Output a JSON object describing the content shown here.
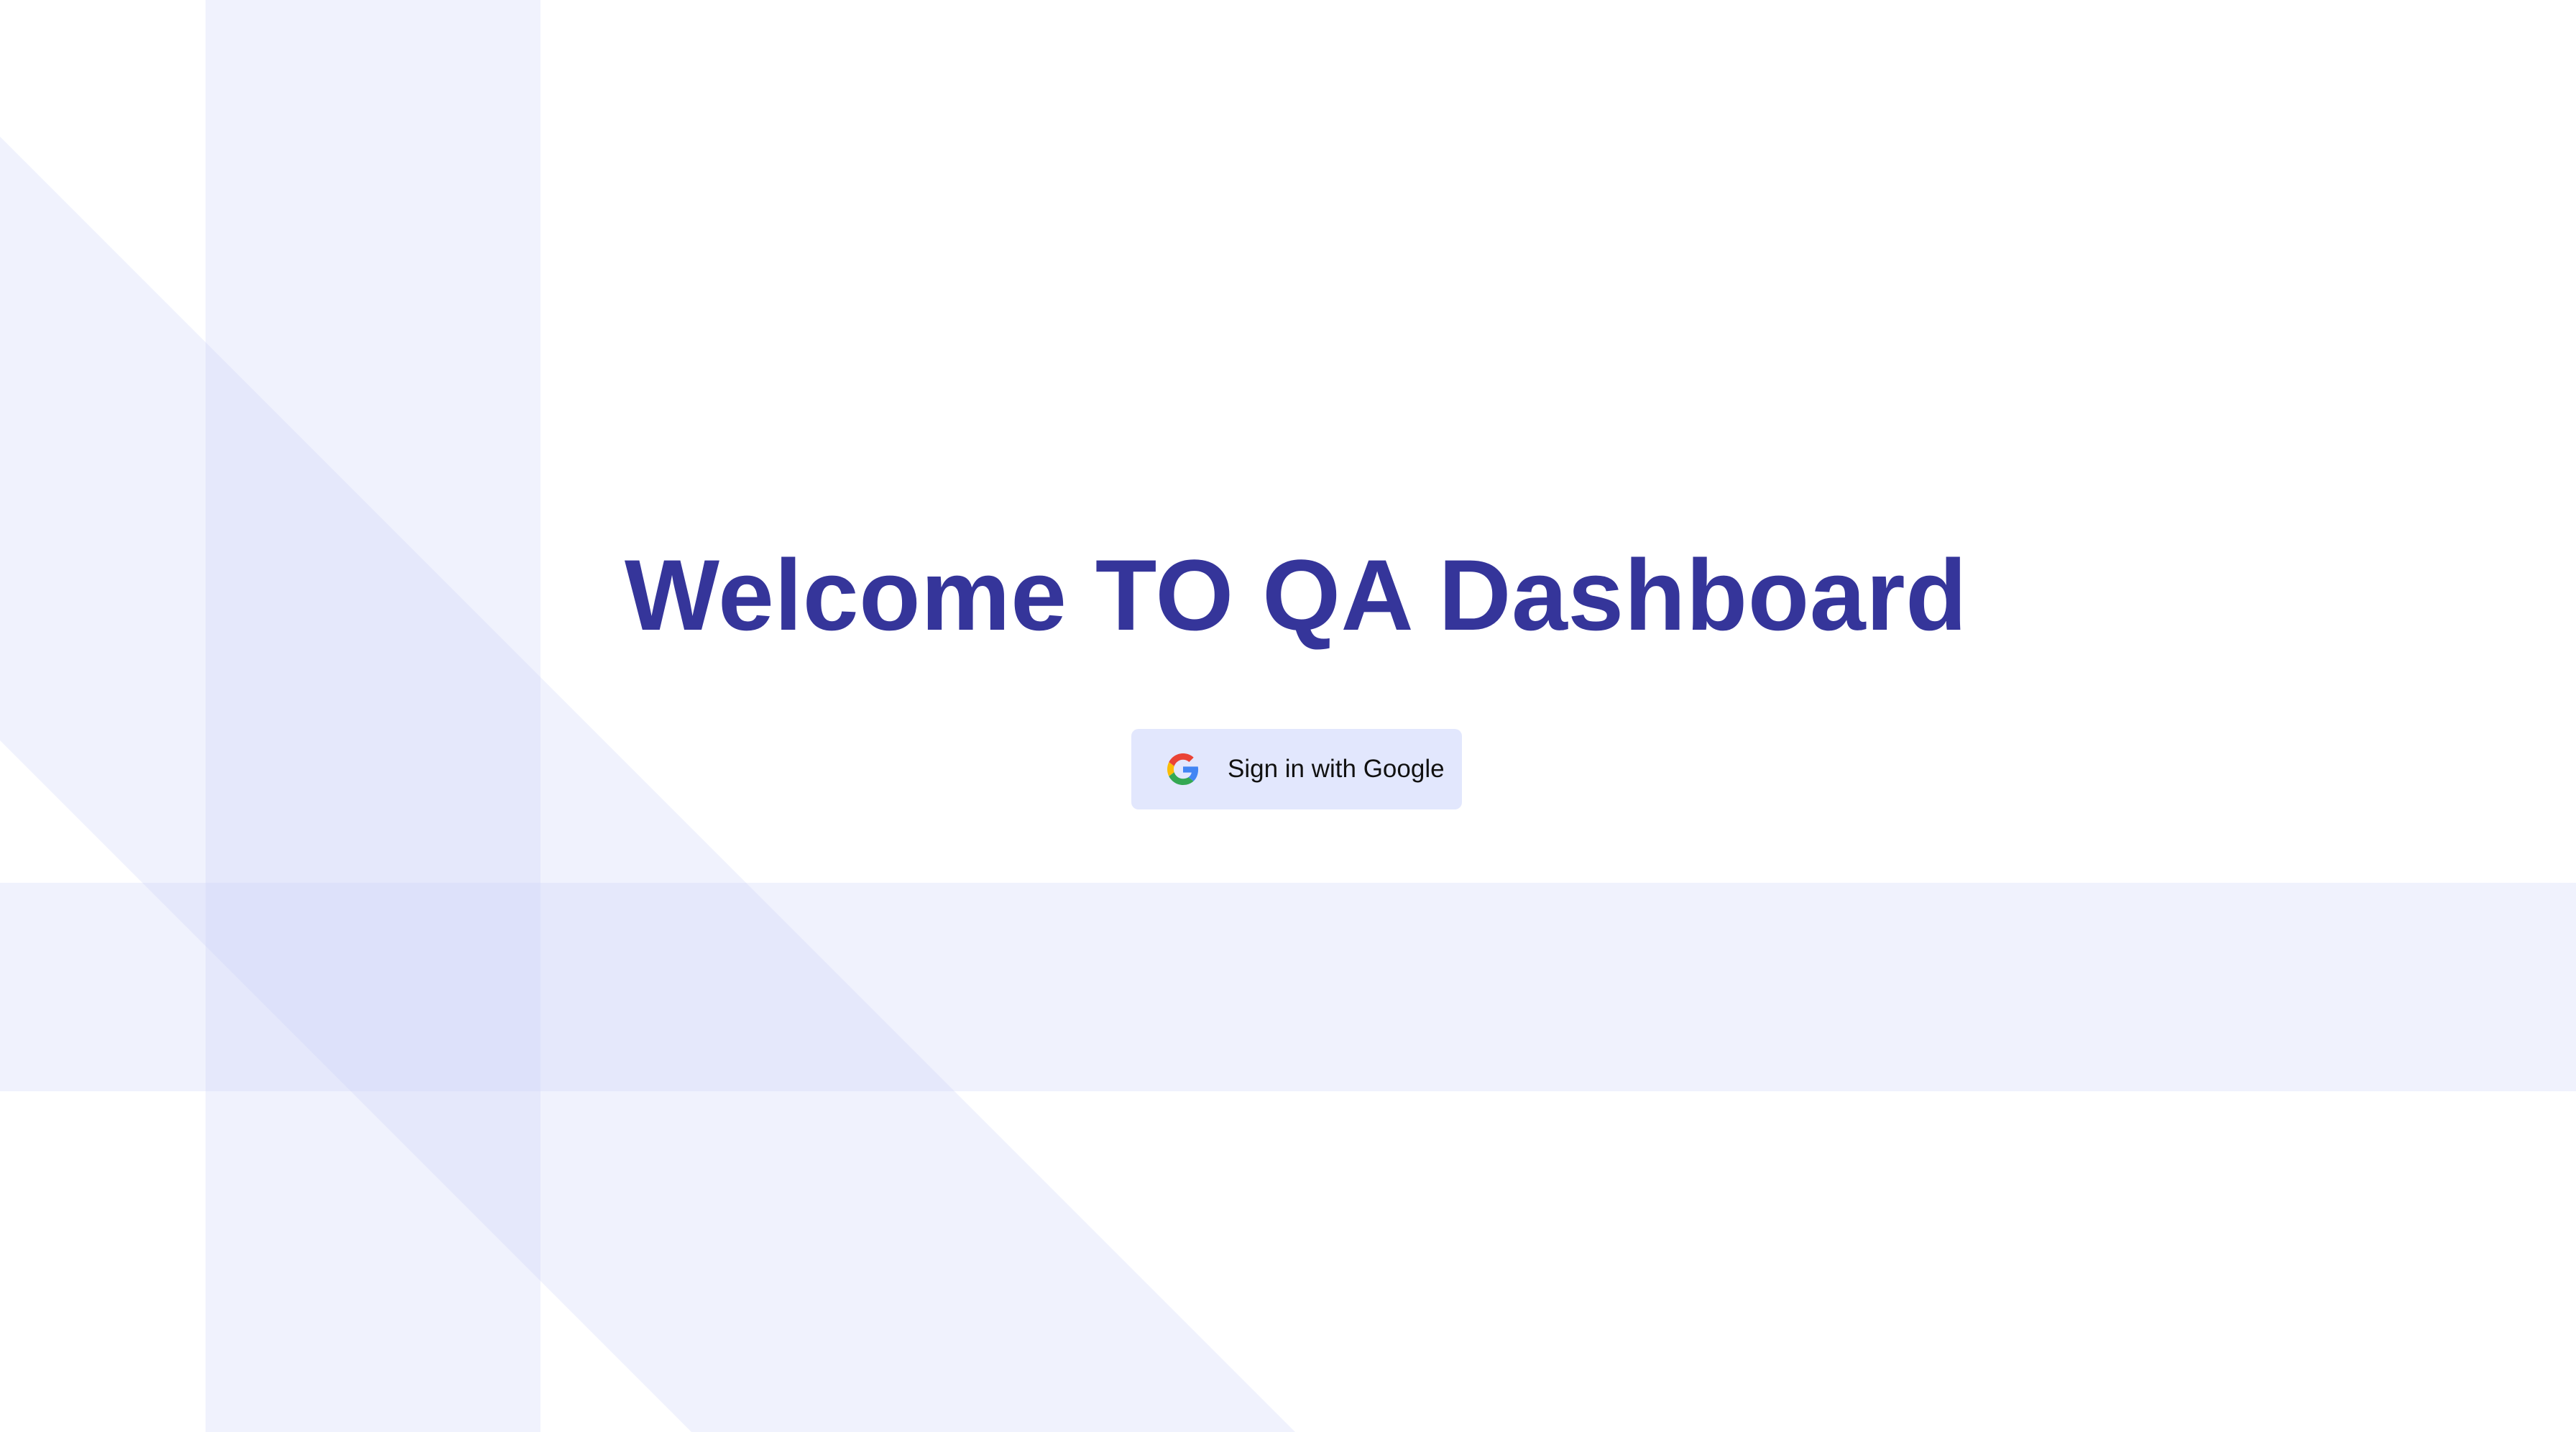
{
  "page": {
    "title": "Welcome TO QA Dashboard"
  },
  "signin": {
    "button_label": "Sign in with Google",
    "icon": "google-logo-icon"
  },
  "colors": {
    "title": "#35359a",
    "button_bg": "#e2e7fd",
    "button_text": "#111111",
    "background": "#ffffff",
    "stripe": "#c8d0f8",
    "google_blue": "#4285F4",
    "google_red": "#EA4335",
    "google_yellow": "#FBBC05",
    "google_green": "#34A853"
  }
}
